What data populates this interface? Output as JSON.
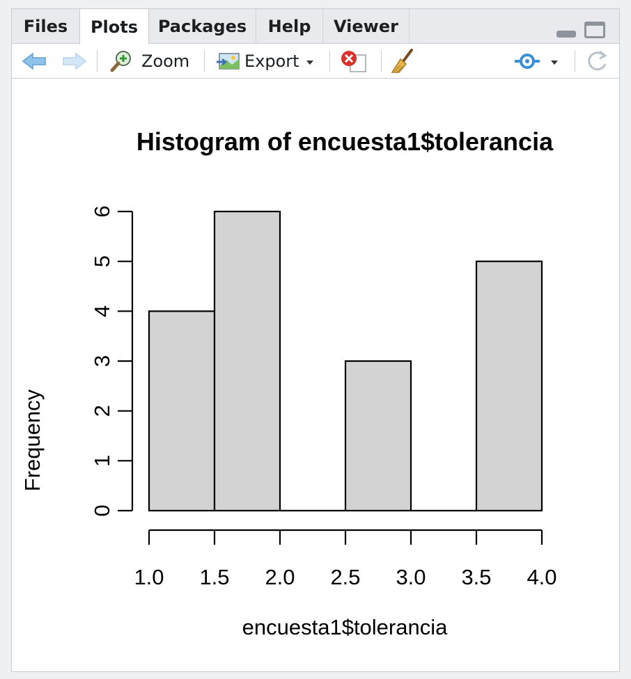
{
  "tabs": [
    {
      "label": "Files",
      "active": false
    },
    {
      "label": "Plots",
      "active": true
    },
    {
      "label": "Packages",
      "active": false
    },
    {
      "label": "Help",
      "active": false
    },
    {
      "label": "Viewer",
      "active": false
    }
  ],
  "toolbar": {
    "back_icon": "arrow-left-icon",
    "forward_icon": "arrow-right-icon",
    "zoom_label": "Zoom",
    "export_label": "Export",
    "remove_icon": "remove-plot-icon",
    "clear_icon": "broom-icon",
    "publish_icon": "publish-icon",
    "refresh_icon": "refresh-icon"
  },
  "chart_data": {
    "type": "bar",
    "title": "Histogram of encuesta1$tolerancia",
    "xlabel": "encuesta1$tolerancia",
    "ylabel": "Frequency",
    "bins": [
      {
        "start": 1.0,
        "end": 1.5,
        "count": 4
      },
      {
        "start": 1.5,
        "end": 2.0,
        "count": 6
      },
      {
        "start": 2.0,
        "end": 2.5,
        "count": 0
      },
      {
        "start": 2.5,
        "end": 3.0,
        "count": 3
      },
      {
        "start": 3.0,
        "end": 3.5,
        "count": 0
      },
      {
        "start": 3.5,
        "end": 4.0,
        "count": 5
      }
    ],
    "x_ticks": [
      "1.0",
      "1.5",
      "2.0",
      "2.5",
      "3.0",
      "3.5",
      "4.0"
    ],
    "y_ticks": [
      "0",
      "1",
      "2",
      "3",
      "4",
      "5",
      "6"
    ],
    "xlim": [
      1.0,
      4.0
    ],
    "ylim": [
      0,
      6
    ],
    "bar_fill": "#d3d3d3",
    "grid": false
  }
}
